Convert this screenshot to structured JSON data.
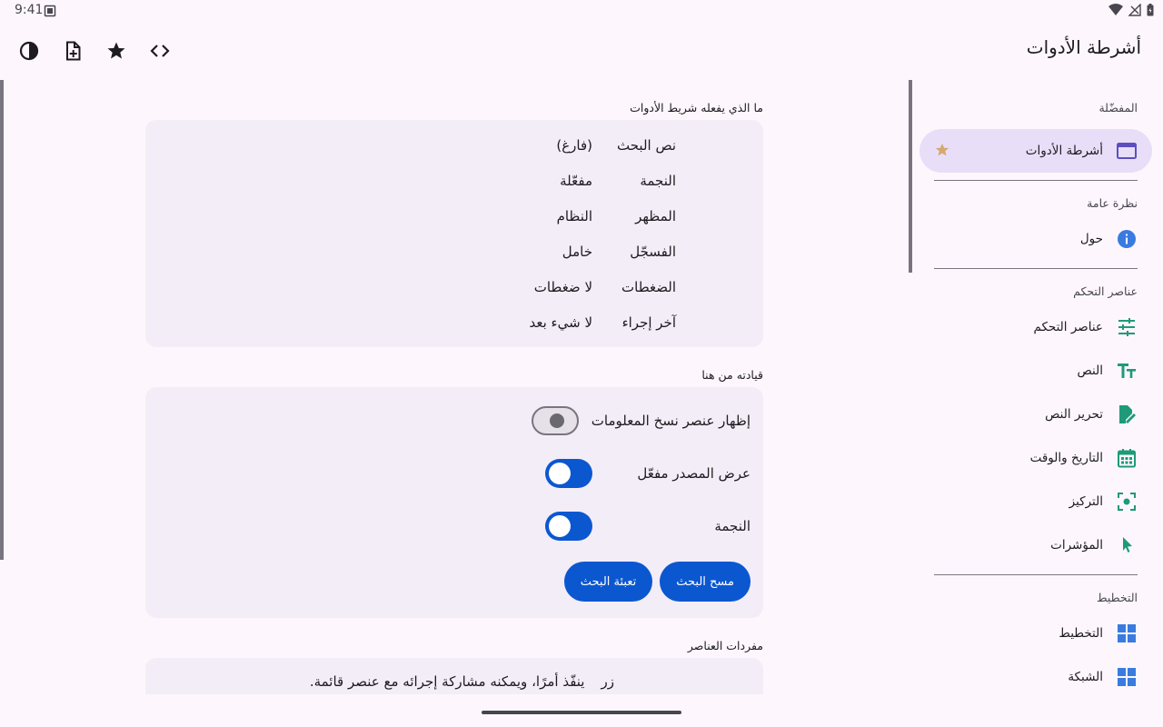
{
  "status": {
    "time": "9:41"
  },
  "app": {
    "title": "أشرطة الأدوات"
  },
  "nav": {
    "favorites_label": "المفضّلة",
    "favorite_item": "أشرطة الأدوات",
    "overview_label": "نظرة عامة",
    "about_item": "حول",
    "controls_label": "عناصر التحكم",
    "controls_items": [
      "عناصر التحكم",
      "النص",
      "تحرير النص",
      "التاريخ والوقت",
      "التركيز",
      "المؤشرات"
    ],
    "layout_label": "التخطيط",
    "layout_items": [
      "التخطيط",
      "الشبكة"
    ]
  },
  "main": {
    "what_label": "ما الذي يفعله شريط الأدوات",
    "info_rows": [
      {
        "key": "نص البحث",
        "value": "(فارغ)"
      },
      {
        "key": "النجمة",
        "value": "مفعّلة"
      },
      {
        "key": "المظهر",
        "value": "النظام"
      },
      {
        "key": "الفسجّل",
        "value": "خامل"
      },
      {
        "key": "الضغطات",
        "value": "لا ضغطات"
      },
      {
        "key": "آخر إجراء",
        "value": "لا شيء بعد"
      }
    ],
    "drive_label": "قيادته من هنا",
    "toggles": [
      {
        "label": "إظهار عنصر نسخ المعلومات",
        "state": "off"
      },
      {
        "label": "عرض المصدر مفعّل",
        "state": "on"
      },
      {
        "label": "النجمة",
        "state": "on"
      }
    ],
    "clear_search": "مسح البحث",
    "fill_search": "تعبئة البحث",
    "glossary_label": "مفردات العناصر",
    "glossary_rows": [
      {
        "key": "زر",
        "value": "ينفّذ أمرًا، ويمكنه مشاركة إجرائه مع عنصر قائمة."
      }
    ]
  },
  "colors": {
    "accent": "#0b57d0",
    "surface": "#fdf7fd",
    "card": "#f3edf7",
    "nav_active": "#e8def8",
    "icon_green": "#1e9a7a"
  }
}
